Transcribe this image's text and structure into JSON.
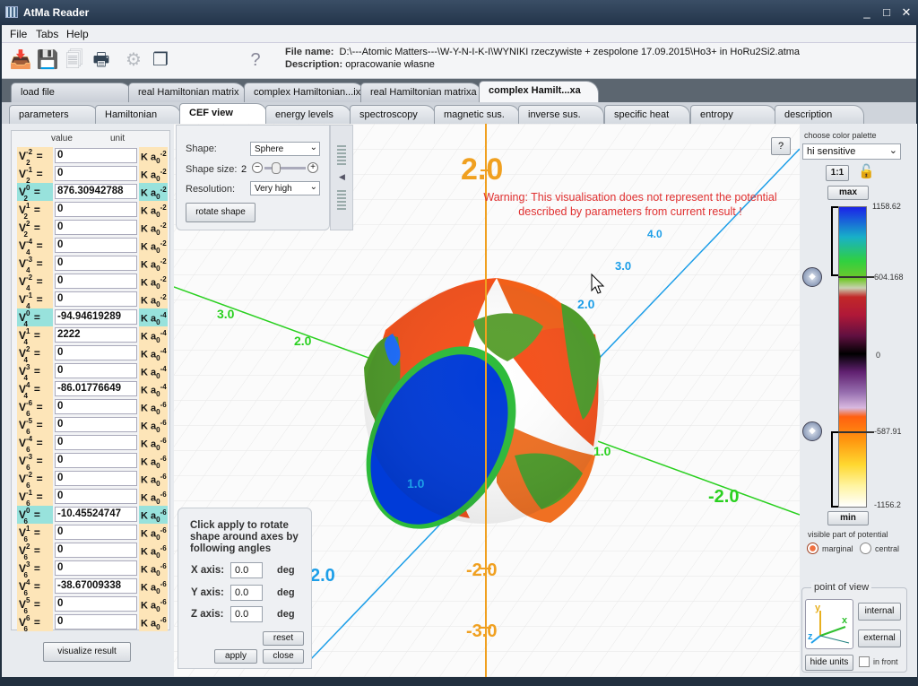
{
  "window": {
    "title": "AtMa Reader",
    "min": "_",
    "max": "□",
    "close": "✕"
  },
  "menu": [
    "File",
    "Tabs",
    "Help"
  ],
  "fileinfo": {
    "name_label": "File name:",
    "name": "D:\\---Atomic Matters---\\W-Y-N-I-K-I\\WYNIKI rzeczywiste + zespolone 17.09.2015\\Ho3+ in HoRu2Si2.atma",
    "desc_label": "Description:",
    "desc": "opracowanie własne"
  },
  "tabs1": [
    "load file",
    "real Hamiltonian matrix",
    "complex Hamiltonian...ix",
    "real Hamiltonian matrixa",
    "complex Hamilt...xa"
  ],
  "tabs2": [
    "parameters",
    "Hamiltonian",
    "CEF view",
    "energy levels",
    "spectroscopy",
    "magnetic sus.",
    "inverse sus.",
    "specific heat",
    "entropy",
    "description"
  ],
  "params": {
    "col_value": "value",
    "col_unit": "unit",
    "visualize": "visualize result",
    "rows": [
      {
        "n": "2",
        "k": "-2",
        "v": "0",
        "u": "-2",
        "c": false
      },
      {
        "n": "2",
        "k": "-1",
        "v": "0",
        "u": "-2",
        "c": false
      },
      {
        "n": "2",
        "k": "0",
        "v": "876.30942788",
        "u": "-2",
        "c": true
      },
      {
        "n": "2",
        "k": "1",
        "v": "0",
        "u": "-2",
        "c": false
      },
      {
        "n": "2",
        "k": "2",
        "v": "0",
        "u": "-2",
        "c": false
      },
      {
        "n": "4",
        "k": "-4",
        "v": "0",
        "u": "-2",
        "c": false
      },
      {
        "n": "4",
        "k": "-3",
        "v": "0",
        "u": "-2",
        "c": false
      },
      {
        "n": "4",
        "k": "-2",
        "v": "0",
        "u": "-2",
        "c": false
      },
      {
        "n": "4",
        "k": "-1",
        "v": "0",
        "u": "-2",
        "c": false
      },
      {
        "n": "4",
        "k": "0",
        "v": "-94.94619289",
        "u": "-4",
        "c": true
      },
      {
        "n": "4",
        "k": "1",
        "v": "2222",
        "u": "-4",
        "c": false
      },
      {
        "n": "4",
        "k": "2",
        "v": "0",
        "u": "-4",
        "c": false
      },
      {
        "n": "4",
        "k": "3",
        "v": "0",
        "u": "-4",
        "c": false
      },
      {
        "n": "4",
        "k": "4",
        "v": "-86.01776649",
        "u": "-4",
        "c": false
      },
      {
        "n": "6",
        "k": "-6",
        "v": "0",
        "u": "-6",
        "c": false
      },
      {
        "n": "6",
        "k": "-5",
        "v": "0",
        "u": "-6",
        "c": false
      },
      {
        "n": "6",
        "k": "-4",
        "v": "0",
        "u": "-6",
        "c": false
      },
      {
        "n": "6",
        "k": "-3",
        "v": "0",
        "u": "-6",
        "c": false
      },
      {
        "n": "6",
        "k": "-2",
        "v": "0",
        "u": "-6",
        "c": false
      },
      {
        "n": "6",
        "k": "-1",
        "v": "0",
        "u": "-6",
        "c": false
      },
      {
        "n": "6",
        "k": "0",
        "v": "-10.45524747",
        "u": "-6",
        "c": true
      },
      {
        "n": "6",
        "k": "1",
        "v": "0",
        "u": "-6",
        "c": false
      },
      {
        "n": "6",
        "k": "2",
        "v": "0",
        "u": "-6",
        "c": false
      },
      {
        "n": "6",
        "k": "3",
        "v": "0",
        "u": "-6",
        "c": false
      },
      {
        "n": "6",
        "k": "4",
        "v": "-38.67009338",
        "u": "-6",
        "c": false
      },
      {
        "n": "6",
        "k": "5",
        "v": "0",
        "u": "-6",
        "c": false
      },
      {
        "n": "6",
        "k": "6",
        "v": "0",
        "u": "-6",
        "c": false
      }
    ]
  },
  "shape": {
    "shape_label": "Shape:",
    "shape_value": "Sphere",
    "size_label": "Shape size:",
    "size_value": "2",
    "res_label": "Resolution:",
    "res_value": "Very high",
    "rotate": "rotate shape"
  },
  "view": {
    "warning": "Warning: This visualisation does not represent the potential described by parameters from current result !",
    "help": "?",
    "axis_labels": [
      "2.0",
      "-2.0",
      "-3.0",
      "4.0",
      "3.0",
      "2.0",
      "1.0",
      "2.0",
      "3.0",
      "2.0",
      "-2.0",
      "1.0"
    ]
  },
  "rotate": {
    "text": "Click apply to rotate shape around axes by following angles",
    "x_label": "X axis:",
    "y_label": "Y axis:",
    "z_label": "Z axis:",
    "x": "0.0",
    "y": "0.0",
    "z": "0.0",
    "deg": "deg",
    "reset": "reset",
    "apply": "apply",
    "close": "close"
  },
  "palette": {
    "label": "choose color palette",
    "value": "hi sensitive",
    "ratio": "1:1",
    "max_btn": "max",
    "min_btn": "min",
    "ticks": [
      "1158.62",
      "604.168",
      "0",
      "-587.91",
      "-1156.2"
    ],
    "visible_label": "visible part of potential",
    "marginal": "marginal",
    "central": "central"
  },
  "pov": {
    "label": "point of view",
    "internal": "internal",
    "external": "external",
    "hide_units": "hide units",
    "in_front": "in front"
  },
  "colors": {
    "orange_axis": "#f0a020",
    "blue_axis": "#1c9ee8",
    "green_axis": "#2ad020",
    "warning": "#e03030"
  }
}
